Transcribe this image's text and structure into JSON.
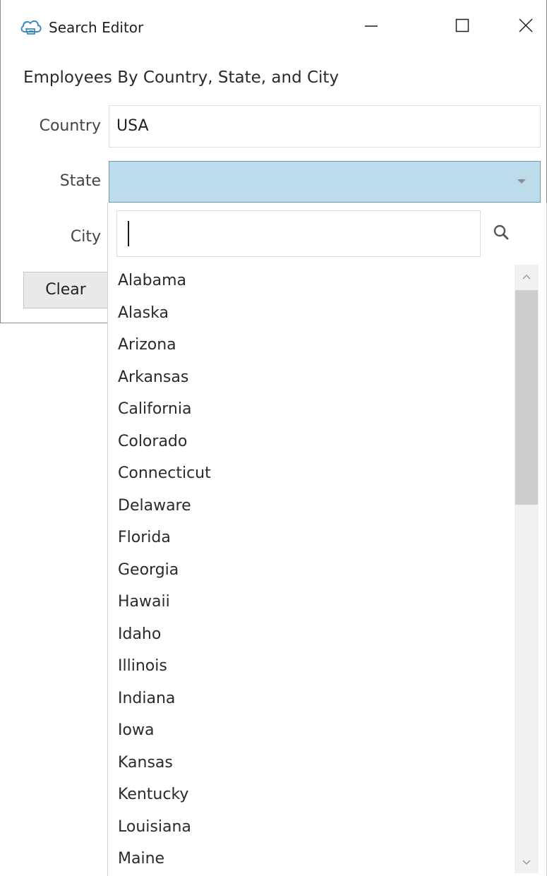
{
  "window": {
    "title": "Search Editor",
    "app_icon": "cloud-app-icon",
    "controls": {
      "minimize": "minimize-icon",
      "maximize": "maximize-icon",
      "close": "close-icon"
    }
  },
  "form": {
    "heading": "Employees By Country, State, and City",
    "country_label": "Country",
    "country_value": "USA",
    "state_label": "State",
    "state_value": "",
    "city_label": "City",
    "clear_label": "Clear"
  },
  "state_dropdown": {
    "search_value": "",
    "search_icon": "search-icon",
    "items": [
      "Alabama",
      "Alaska",
      "Arizona",
      "Arkansas",
      "California",
      "Colorado",
      "Connecticut",
      "Delaware",
      "Florida",
      "Georgia",
      "Hawaii",
      "Idaho",
      "Illinois",
      "Indiana",
      "Iowa",
      "Kansas",
      "Kentucky",
      "Louisiana",
      "Maine"
    ]
  },
  "colors": {
    "selected_field_bg": "#bcdcec",
    "selected_field_border": "#6b9bb4",
    "icon_blue": "#3a8ab8"
  }
}
